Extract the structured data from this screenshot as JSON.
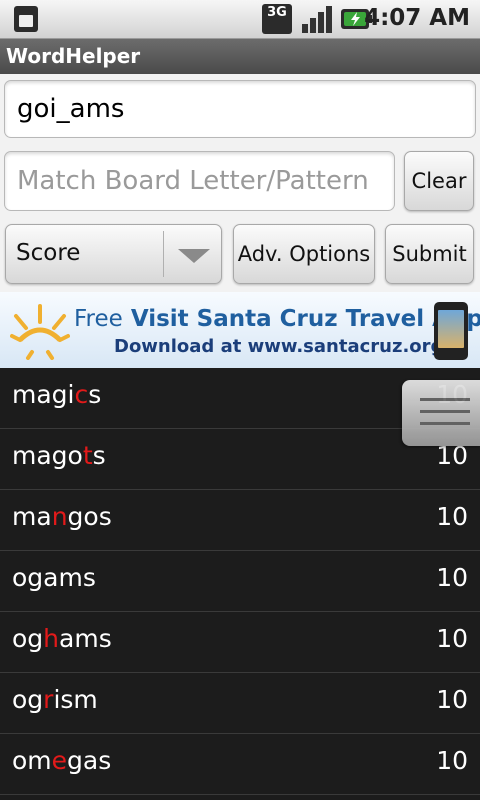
{
  "status_bar": {
    "time": "4:07 AM",
    "network_label": "3G",
    "icons": [
      "sim-icon",
      "3g-icon",
      "signal-icon",
      "battery-icon"
    ]
  },
  "app": {
    "title": "WordHelper"
  },
  "form": {
    "letters_value": "goi_ams",
    "pattern_placeholder": "Match Board Letter/Pattern",
    "clear_label": "Clear",
    "sort_selected": "Score",
    "adv_options_label": "Adv. Options",
    "submit_label": "Submit"
  },
  "banner": {
    "line1_free": "Free",
    "line1_rest": "Visit Santa Cruz Travel App",
    "line2": "Download at www.santacruz.org"
  },
  "results": [
    {
      "pre": "magi",
      "hl": "c",
      "post": "s",
      "score": "10"
    },
    {
      "pre": "mago",
      "hl": "t",
      "post": "s",
      "score": "10"
    },
    {
      "pre": "ma",
      "hl": "n",
      "post": "gos",
      "score": "10"
    },
    {
      "pre": "ogams",
      "hl": "",
      "post": "",
      "score": "10"
    },
    {
      "pre": "og",
      "hl": "h",
      "post": "ams",
      "score": "10"
    },
    {
      "pre": "og",
      "hl": "r",
      "post": "ism",
      "score": "10"
    },
    {
      "pre": "om",
      "hl": "e",
      "post": "gas",
      "score": "10"
    }
  ],
  "colors": {
    "highlight": "#e21a1a",
    "list_background": "#1c1c1c",
    "title_bar": "#555555",
    "banner_text": "#1f5f9f"
  }
}
